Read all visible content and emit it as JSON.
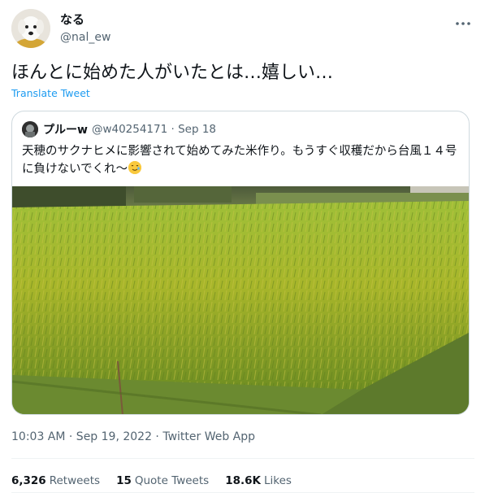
{
  "author": {
    "display_name": "なる",
    "handle": "@nal_ew",
    "avatar_icon": "dog-avatar-icon"
  },
  "more_icon": "more-dots-icon",
  "tweet": {
    "text": "ほんとに始めた人がいたとは…嬉しい…",
    "translate_label": "Translate Tweet"
  },
  "quoted": {
    "name": "プルーw",
    "handle": "@w40254171",
    "date": "Sep 18",
    "text": "天穂のサクナヒメに影響されて始めてみた米作り。もうすぐ収穫だから台風１４号に負けないでくれ〜",
    "emoji": "smiling-face-with-tear-emoji",
    "image": "rice-paddy-photo"
  },
  "meta": {
    "time": "10:03 AM · Sep 19, 2022 · Twitter Web App"
  },
  "stats": {
    "retweets_count": "6,326",
    "retweets_label": "Retweets",
    "quotes_count": "15",
    "quotes_label": "Quote Tweets",
    "likes_count": "18.6K",
    "likes_label": "Likes"
  },
  "colors": {
    "link": "#1d9bf0",
    "secondary_text": "#536471",
    "border": "#cfd9de"
  }
}
